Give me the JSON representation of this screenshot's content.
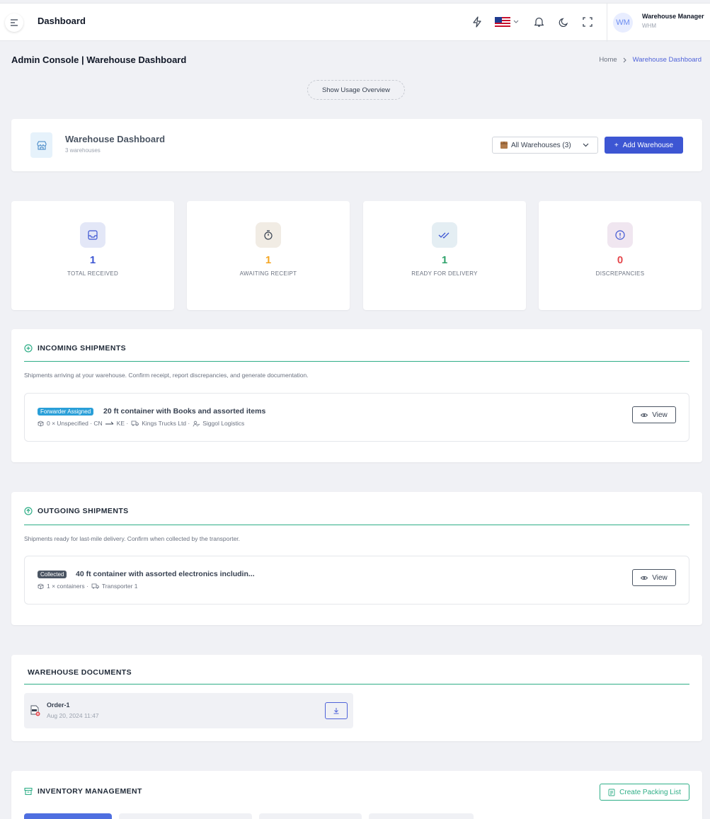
{
  "topbar": {
    "title": "Dashboard",
    "user_initials": "WM",
    "user_name": "Warehouse Manager",
    "user_role": "WHM",
    "icons": [
      "menu-icon",
      "lightning-icon",
      "us-flag-icon",
      "bell-icon",
      "moon-icon",
      "fullscreen-icon"
    ]
  },
  "page": {
    "title": "Admin Console | Warehouse Dashboard",
    "breadcrumb": [
      "Home",
      "Warehouse Dashboard"
    ],
    "usage_button": "Show Usage Overview"
  },
  "warehouse": {
    "title": "Warehouse Dashboard",
    "subtitle": "3 warehouses",
    "select_value": "All Warehouses (3)",
    "add_button": "Add Warehouse"
  },
  "stats": [
    {
      "value": "1",
      "label": "TOTAL RECEIVED",
      "color": "#3d56d3",
      "bg": "#e3e7f7",
      "icon": "inbox-icon"
    },
    {
      "value": "1",
      "label": "AWAITING RECEIPT",
      "color": "#f5a623",
      "bg": "#f1ece4",
      "icon": "timer-icon"
    },
    {
      "value": "1",
      "label": "READY FOR DELIVERY",
      "color": "#2fa36b",
      "bg": "#e4eef3",
      "icon": "double-check-icon"
    },
    {
      "value": "0",
      "label": "DISCREPANCIES",
      "color": "#e5484d",
      "bg": "#f0e6f0",
      "icon": "alert-circle-icon"
    }
  ],
  "incoming": {
    "heading": "INCOMING SHIPMENTS",
    "description": "Shipments arriving at your warehouse. Confirm receipt, report discrepancies, and generate documentation.",
    "item": {
      "badge": "Forwarder Assigned",
      "title": "20 ft container with Books and assorted items",
      "meta_qty": "0 × Unspecified · CN",
      "meta_dest": "KE ·",
      "meta_trucks": "Kings Trucks Ltd ·",
      "meta_forwarder": "Siggol Logistics",
      "view": "View"
    }
  },
  "outgoing": {
    "heading": "OUTGOING SHIPMENTS",
    "description": "Shipments ready for last-mile delivery. Confirm when collected by the transporter.",
    "item": {
      "badge": "Collected",
      "title": "40 ft container with assorted electronics includin...",
      "meta_qty": "1 × containers ·",
      "meta_transporter": "Transporter 1",
      "view": "View"
    }
  },
  "documents": {
    "heading": "WAREHOUSE DOCUMENTS",
    "item": {
      "name": "Order-1",
      "date": "Aug 20, 2024 11:47"
    }
  },
  "inventory": {
    "heading": "INVENTORY MANAGEMENT",
    "packing_button": "Create Packing List"
  }
}
